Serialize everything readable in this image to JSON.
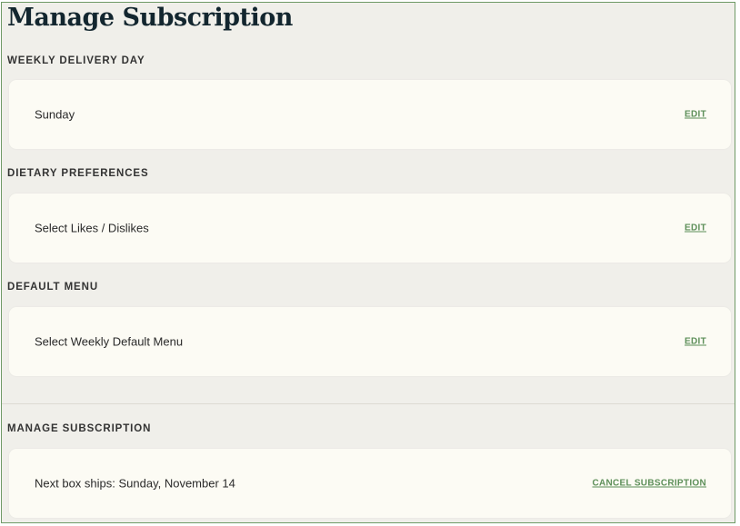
{
  "page": {
    "title": "Manage Subscription"
  },
  "sections": {
    "delivery": {
      "label": "WEEKLY DELIVERY DAY",
      "value": "Sunday",
      "action": "EDIT"
    },
    "dietary": {
      "label": "DIETARY PREFERENCES",
      "value": "Select Likes / Dislikes",
      "action": "EDIT"
    },
    "menu": {
      "label": "DEFAULT MENU",
      "value": "Select Weekly Default Menu",
      "action": "EDIT"
    },
    "subscription": {
      "label": "MANAGE SUBSCRIPTION",
      "value": "Next box ships: Sunday, November 14",
      "action": "CANCEL SUBSCRIPTION"
    }
  },
  "colors": {
    "accent": "#5d8f59",
    "background": "#f0efea",
    "card": "#fcfbf4",
    "title": "#13262f"
  }
}
